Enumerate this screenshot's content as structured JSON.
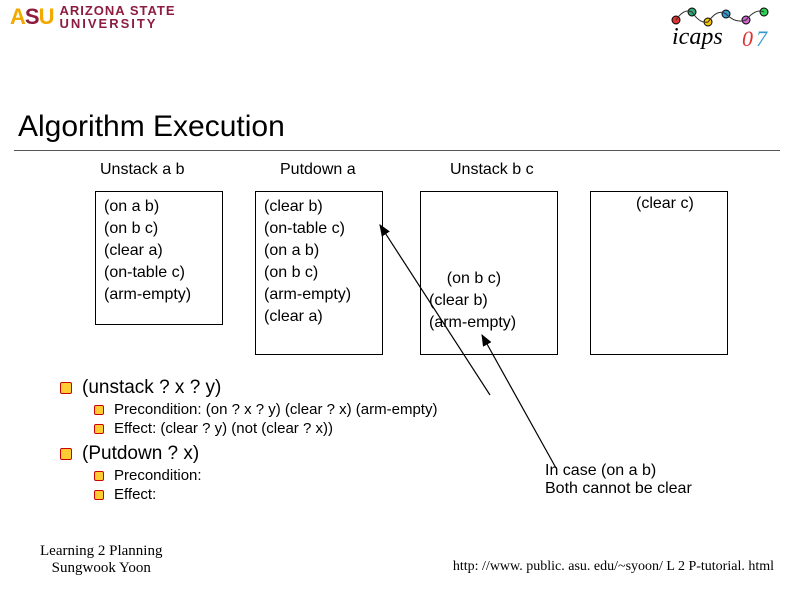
{
  "logo": {
    "asu_line1": "ARIZONA STATE",
    "asu_line2": "UNIVERSITY",
    "icaps_text": "icaps",
    "icaps_year": "07"
  },
  "title": "Algorithm Execution",
  "ops": {
    "op1": "Unstack a b",
    "op2": "Putdown a",
    "op3": "Unstack b c"
  },
  "states": {
    "s1": "(on a b)\n(on b c)\n(clear a)\n(on-table c)\n(arm-empty)",
    "s2": "(clear b)\n(on-table c)\n(on a b)\n(on b c)\n(arm-empty)\n(clear a)",
    "s3": "(on b c)\n(clear b)\n(arm-empty)",
    "s4": "(clear c)"
  },
  "rules": {
    "unstack_head": "(unstack ? x ? y)",
    "unstack_pre_label": "Precondition: ",
    "unstack_pre": "(on ? x ? y) (clear ? x)  (arm-empty)",
    "unstack_eff_label": "Effect: ",
    "unstack_eff": "(clear ? y) (not (clear ? x))",
    "putdown_head": "(Putdown ? x)",
    "putdown_pre_label": "Precondition:",
    "putdown_eff_label": "Effect:"
  },
  "note": "In case (on a b)\nBoth cannot be clear",
  "footer": {
    "left1": "Learning 2 Planning",
    "left2": "Sungwook Yoon",
    "right": "http: //www. public. asu. edu/~syoon/ L 2 P-tutorial. html"
  }
}
